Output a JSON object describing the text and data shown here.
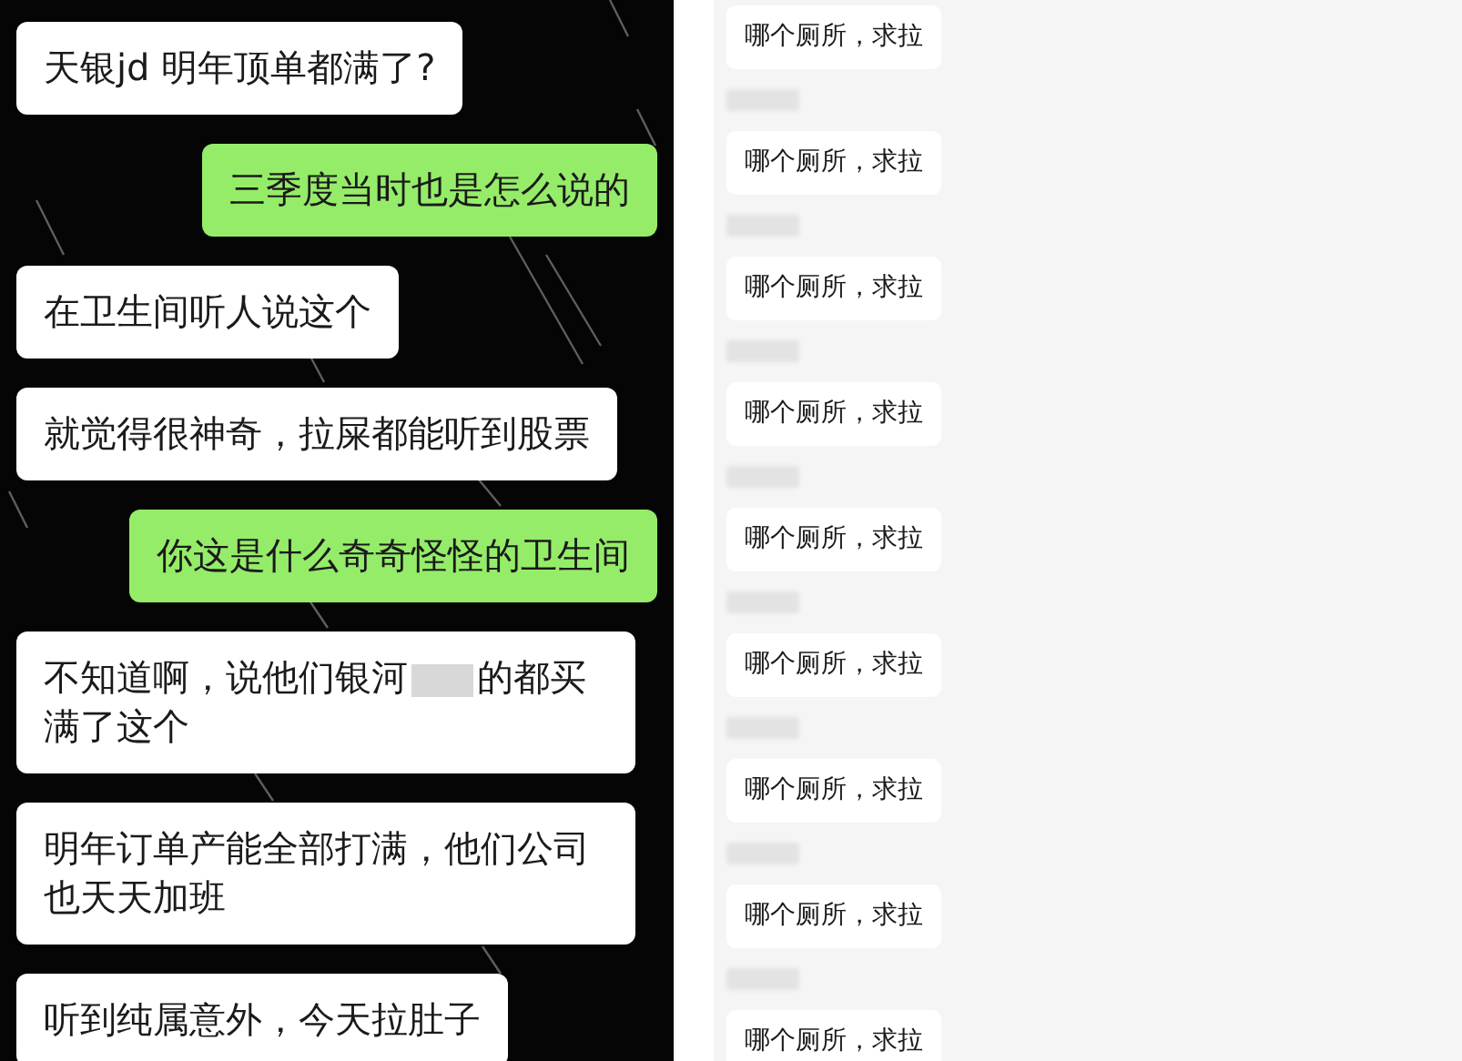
{
  "left_chat": {
    "messages": [
      {
        "outgoing": false,
        "segments": [
          "天银jd 明年顶单都满了?"
        ]
      },
      {
        "outgoing": true,
        "segments": [
          "三季度当时也是怎么说的"
        ]
      },
      {
        "outgoing": false,
        "segments": [
          "在卫生间听人说这个"
        ]
      },
      {
        "outgoing": false,
        "segments": [
          "就觉得很神奇，拉屎都能听到股票"
        ]
      },
      {
        "outgoing": true,
        "segments": [
          "你这是什么奇奇怪怪的卫生间"
        ]
      },
      {
        "outgoing": false,
        "segments": [
          "不知道啊，说他们银河",
          "的都买满了这个"
        ]
      },
      {
        "outgoing": false,
        "segments": [
          "明年订单产能全部打满，他们公司也天天加班"
        ]
      },
      {
        "outgoing": false,
        "segments": [
          "听到纯属意外，今天拉肚子"
        ]
      }
    ]
  },
  "right_chat": {
    "messages": [
      {
        "text": "哪个厕所，求拉"
      },
      {
        "text": "哪个厕所，求拉"
      },
      {
        "text": "哪个厕所，求拉"
      },
      {
        "text": "哪个厕所，求拉"
      },
      {
        "text": "哪个厕所，求拉"
      },
      {
        "text": "哪个厕所，求拉"
      },
      {
        "text": "哪个厕所，求拉"
      },
      {
        "text": "哪个厕所，求拉"
      },
      {
        "text": "哪个厕所，求拉"
      }
    ]
  }
}
